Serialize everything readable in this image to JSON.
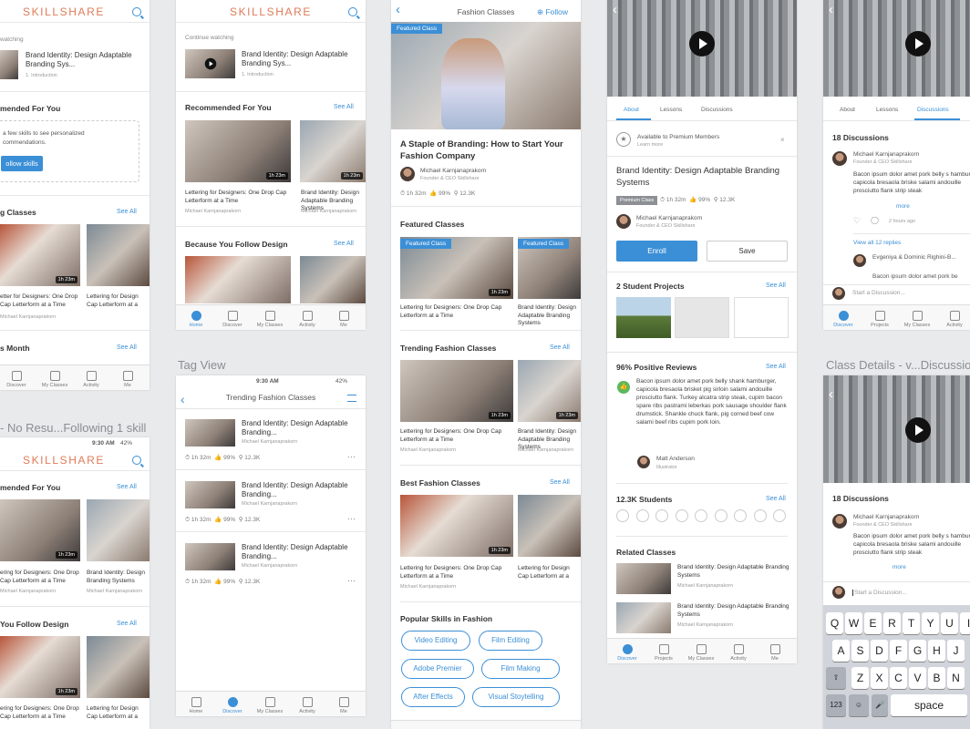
{
  "artboards": {
    "tag_view": "Tag View",
    "no_results": "- No Resu...Following 1 skill",
    "class_details_discussion": "Class Details - v...Discussion"
  },
  "app": {
    "logo": "SKILLSHARE",
    "accent": "#3b8fd6",
    "logo_color": "#e07a58"
  },
  "tabs": {
    "home": "Home",
    "discover": "Discover",
    "my_classes": "My Classes",
    "activity": "Activity",
    "me": "Me",
    "projects": "Projects"
  },
  "home": {
    "continue_watching": "Continue watching",
    "cw_title": "Brand Identity: Design Adaptable Branding Sys...",
    "cw_sub": "1. Introduction",
    "recommended": "Recommended For You",
    "see_all": "See All",
    "because_follow": "Because You Follow Design",
    "card1_title": "Lettering for Designers: One Drop Cap Letterform at a Time",
    "card2_title": "Brand Identity: Design Adaptable Branding Systems",
    "author": "Michael Karnjanaprakorn",
    "dur": "1h 23m"
  },
  "s1": {
    "watching": "watching",
    "cw_title": "Brand Identity: Design Adaptable Branding Sys...",
    "cw_sub": "1. Introduction",
    "rec": "mended For You",
    "empty1": "a few skills to see personalized",
    "empty2": "commendations.",
    "follow_btn": "ollow skills",
    "classes": "g Classes",
    "month": "s Month",
    "card1": "Lettering for Designers: One Drop Cap Letterform at a Time",
    "card1_cut": "etter for Designers: One Drop Cap Letterform at a Time",
    "author": "Michael Karnjanaprakorn",
    "card2_cut": "Lettering for Design Cap Letterform at a"
  },
  "s4": {
    "status_time": "9:30 AM",
    "battery": "42%",
    "rec": "mended For You",
    "follow": "You Follow Design",
    "card1": "Lettering for Designers: One Drop Cap Letterform at a Time",
    "card1_cut": "ering for Designers: One Drop Cap Letterform at a Time",
    "card2": "Brand Identity: Design Branding Systems",
    "card2_cut2": "Lettering for Design Cap Letterform at a",
    "author": "Michael Karnjanaprakorn"
  },
  "tag": {
    "status_time": "9:30 AM",
    "battery": "42%",
    "title": "Trending Fashion Classes",
    "row_title": "Brand Identity: Design Adaptable Branding...",
    "row_author": "Michael Karnjanaprakorn",
    "dur": "1h 32m",
    "rating": "99%",
    "students": "12.3K",
    "more": "···"
  },
  "fashion": {
    "nav_title": "Fashion Classes",
    "follow": "Follow",
    "featured_badge": "Featured Class",
    "hero_title": "A Staple of Branding: How to Start Your Fashion Company",
    "teacher": "Michael Karnjanaprakorn",
    "teacher_role": "Founder & CEO Skillshare",
    "dur": "1h 32m",
    "rating": "99%",
    "students": "12.3K",
    "featured": "Featured Classes",
    "trending": "Trending Fashion Classes",
    "best": "Best Fashion Classes",
    "popular": "Popular Skills in Fashion",
    "see_all": "See All",
    "card1": "Lettering for Designers: One Drop Cap Letterform at a Time",
    "card2": "Brand Identity: Design Adaptable Branding Systems",
    "card2_cut": "Lettering for Design Cap Letterform at a",
    "author": "Michael Karnjanaprakorn",
    "skills": [
      "Video Editing",
      "Film Editing",
      "Adobe Premier",
      "Film Making",
      "After Effects",
      "Visual Stoytelling"
    ]
  },
  "details": {
    "tab_about": "About",
    "tab_lessons": "Lessons",
    "tab_discussions": "Discussions",
    "premium_note": "Available to Premium Members",
    "learn_more": "Learn more",
    "title": "Brand Identity: Design Adaptable Branding Systems",
    "premium_badge": "Premium Class",
    "dur": "1h 32m",
    "rating": "99%",
    "students": "12.3K",
    "teacher": "Michael Karnjanaprakorn",
    "teacher_role": "Founder & CEO Skillshare",
    "enroll": "Enroll",
    "save": "Save",
    "projects": "2 Student Projects",
    "reviews": "96% Positive Reviews",
    "review_text": "Bacon ipsum dolor amet pork belly shank hamburger, capicola bresaola brisket pig sirloin salami andouille prosciutto flank. Turkey alcatra strip steak, cupim bacon spare ribs pastrami leberkas pork sausage shoulder flank drumstick. Shankle chuck flank, pig corned beef cow salami beef ribs cupim pork loin.",
    "reviewer": "Matt Anderson",
    "reviewer_role": "Illustrator",
    "students_count": "12.3K Students",
    "related": "Related Classes",
    "related_title": "Brand Identity: Design Adaptable Branding Systems",
    "author": "Michael Karnjanaprakorn",
    "see_all": "See All"
  },
  "disc": {
    "tab_about": "About",
    "tab_lessons": "Lessons",
    "tab_discussions": "Discussions",
    "count": "18 Discussions",
    "name": "Michael Karnjanaprakorn",
    "role": "Founder & CEO Skillshare",
    "text": "Bacon ipsum dolor amet pork belly s hamburger, capicola bresaola briske salami andouille prosciutto flank strip steak",
    "more": "more",
    "time": "2 hours ago",
    "view_replies": "View all 12 replies",
    "reply_name": "Evgeniya & Dominic Righini-B...",
    "reply_text": "Bacon ipsum dolor amet pork be",
    "start": "Start a Discussion...",
    "tab_discover": "Discover",
    "tab_projects": "Projects",
    "tab_my": "My Classes",
    "tab_activity": "Activity"
  },
  "disc2": {
    "count": "18 Discussions",
    "name": "Michael Karnjanaprakorn",
    "role": "Founder & CEO Skillshare",
    "text": "Bacon ipsum dolor amet pork belly s hamburger, capicola bresaola briske salami andouille prosciutto flank strip steak",
    "more": "more",
    "input_placeholder": "Start a Discussion...",
    "row1": [
      "Q",
      "W",
      "E",
      "R",
      "T",
      "Y",
      "U",
      "I"
    ],
    "row2": [
      "A",
      "S",
      "D",
      "F",
      "G",
      "H",
      "J"
    ],
    "row3": [
      "Z",
      "X",
      "C",
      "V",
      "B",
      "N"
    ],
    "num": "123",
    "space": "space"
  }
}
